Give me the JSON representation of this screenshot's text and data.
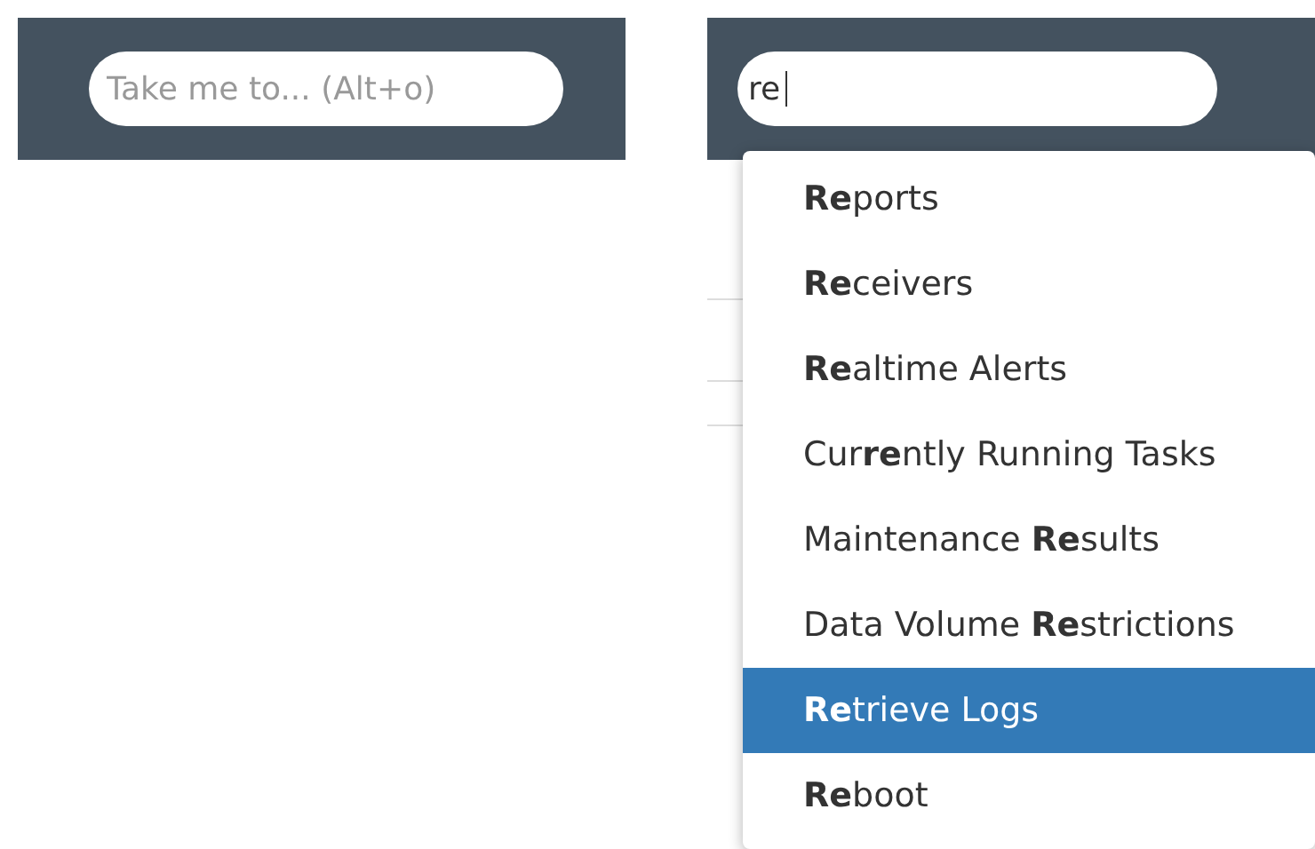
{
  "empty_panel": {
    "search": {
      "placeholder": "Take me to... (Alt+o)"
    }
  },
  "active_panel": {
    "search": {
      "value": "re"
    },
    "suggestions": [
      {
        "label": "**Re**ports",
        "selected": false
      },
      {
        "label": "**Re**ceivers",
        "selected": false
      },
      {
        "label": "**Re**altime Alerts",
        "selected": false
      },
      {
        "label": "Cur**re**ntly Running Tasks",
        "selected": false
      },
      {
        "label": "Maintenance **Re**sults",
        "selected": false
      },
      {
        "label": "Data Volume **Re**strictions",
        "selected": false
      },
      {
        "label": "**Re**trieve Logs",
        "selected": true
      },
      {
        "label": "**Re**boot",
        "selected": false
      }
    ]
  }
}
